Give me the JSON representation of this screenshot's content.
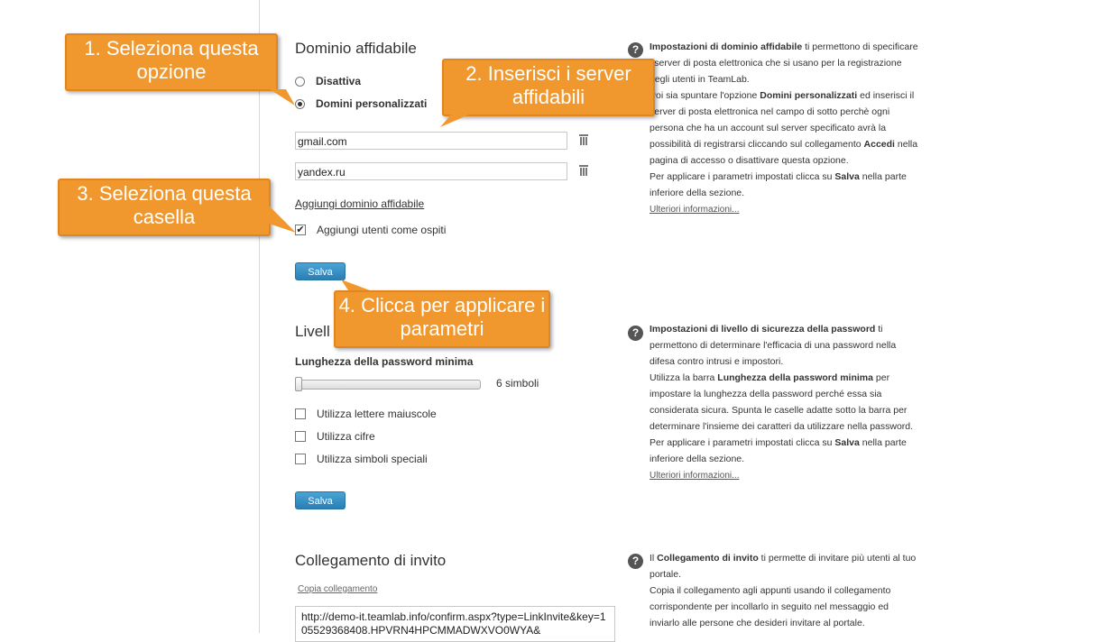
{
  "trusted_domain": {
    "title": "Dominio affidabile",
    "option_disabled": "Disattiva",
    "option_custom": "Domini personalizzati",
    "domains": [
      "gmail.com",
      "yandex.ru"
    ],
    "add_link": "Aggiungi dominio affidabile",
    "guest_checkbox_label": "Aggiungi utenti come ospiti",
    "guest_checked": true,
    "save_label": "Salva",
    "help": {
      "b1": "Impostazioni di dominio affidabile",
      "t1": " ti permettono di specificare i server di posta elettronica che si usano per la registrazione degli utenti in TeamLab.",
      "t2": "Poi sia spuntare l'opzione ",
      "b2": "Domini personalizzati",
      "t3": " ed inserisci il server di posta elettronica nel campo di sotto perchè ogni persona che ha un account sul server specificato avrà la possibilità di registrarsi cliccando sul collegamento ",
      "b3": "Accedi",
      "t4": " nella pagina di accesso o disattivare questa opzione.",
      "t5": "Per applicare i parametri impostati clicca su ",
      "b4": "Salva",
      "t6": " nella parte inferiore della sezione.",
      "more": "Ulteriori informazioni..."
    }
  },
  "password": {
    "title": "Livell",
    "min_length_label": "Lunghezza della password minima",
    "slider_value": "6 simboli",
    "slider_fraction": 0,
    "check_uppercase": "Utilizza lettere maiuscole",
    "check_digits": "Utilizza cifre",
    "check_special": "Utilizza simboli speciali",
    "save_label": "Salva",
    "help": {
      "b1": "Impostazioni di livello di sicurezza della password",
      "t1": " ti permettono di determinare l'efficacia di una password nella difesa contro intrusi e impostori.",
      "t2": "Utilizza la barra ",
      "b2": "Lunghezza della password minima",
      "t3": " per impostare la lunghezza della password perché essa sia considerata sicura. Spunta le caselle adatte sotto la barra per determinare l'insieme dei caratteri da utilizzare nella password.",
      "t4": "Per applicare i parametri impostati clicca su ",
      "b3": "Salva",
      "t5": " nella parte inferiore della sezione.",
      "more": "Ulteriori informazioni..."
    }
  },
  "invite": {
    "title": "Collegamento di invito",
    "copy_link": "Copia collegamento",
    "url": "http://demo-it.teamlab.info/confirm.aspx?type=LinkInvite&key=105529368408.HPVRN4HPCMMADWXVO0WYA&",
    "help": {
      "t1": "Il ",
      "b1": "Collegamento di invito",
      "t2": " ti permette di invitare più utenti al tuo portale.",
      "t3": "Copia il collegamento agli appunti usando il collegamento corrispondente per incollarlo in seguito nel messaggio ed inviarlo alle persone che desideri invitare al portale."
    }
  },
  "callouts": {
    "c1": "1. Seleziona questa opzione",
    "c2": "2. Inserisci i server affidabili",
    "c3": "3. Seleziona questa casella",
    "c4": "4. Clicca per applicare i parametri"
  },
  "colors": {
    "callout": "#f0982e",
    "button": "#2a7fb3"
  },
  "icons": {
    "help": "question-circle-icon",
    "delete": "trash-icon"
  }
}
